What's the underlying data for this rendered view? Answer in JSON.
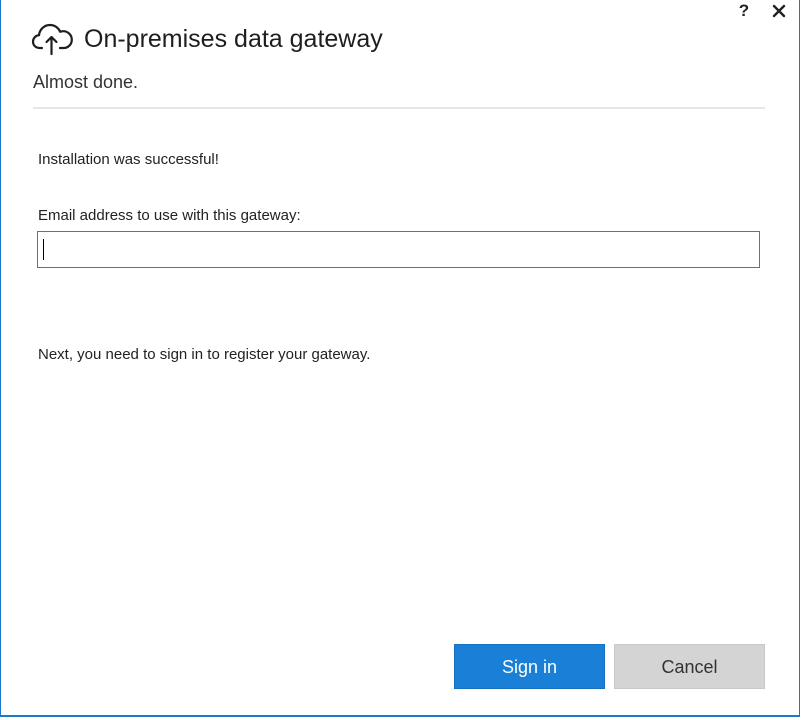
{
  "window": {
    "help_label": "?",
    "close_icon": "close-icon"
  },
  "header": {
    "icon": "cloud-upload-icon",
    "title": "On-premises data gateway",
    "subtitle": "Almost done."
  },
  "main": {
    "status_message": "Installation was successful!",
    "email_label": "Email address to use with this gateway:",
    "email_value": "",
    "email_placeholder": "",
    "next_message": "Next, you need to sign in to register your gateway."
  },
  "footer": {
    "signin_label": "Sign in",
    "cancel_label": "Cancel"
  },
  "colors": {
    "accent": "#1a7fd6",
    "border": "#1979ca",
    "cancel_bg": "#d4d4d4"
  }
}
